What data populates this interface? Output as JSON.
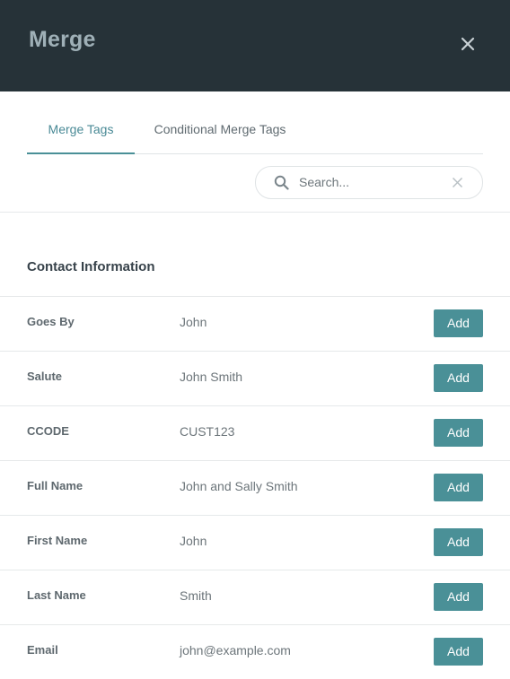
{
  "header": {
    "title": "Merge",
    "close_icon": "close-icon"
  },
  "tabs": [
    {
      "label": "Merge Tags",
      "active": true
    },
    {
      "label": "Conditional Merge Tags",
      "active": false
    }
  ],
  "search": {
    "placeholder": "Search...",
    "value": ""
  },
  "section": {
    "title": "Contact Information"
  },
  "rows": [
    {
      "label": "Goes By",
      "value": "John",
      "action": "Add"
    },
    {
      "label": "Salute",
      "value": "John Smith",
      "action": "Add"
    },
    {
      "label": "CCODE",
      "value": "CUST123",
      "action": "Add"
    },
    {
      "label": "Full Name",
      "value": "John and Sally Smith",
      "action": "Add"
    },
    {
      "label": "First Name",
      "value": "John",
      "action": "Add"
    },
    {
      "label": "Last Name",
      "value": "Smith",
      "action": "Add"
    },
    {
      "label": "Email",
      "value": "john@example.com",
      "action": "Add"
    }
  ],
  "colors": {
    "header_bg": "#263238",
    "accent": "#4a9097"
  }
}
